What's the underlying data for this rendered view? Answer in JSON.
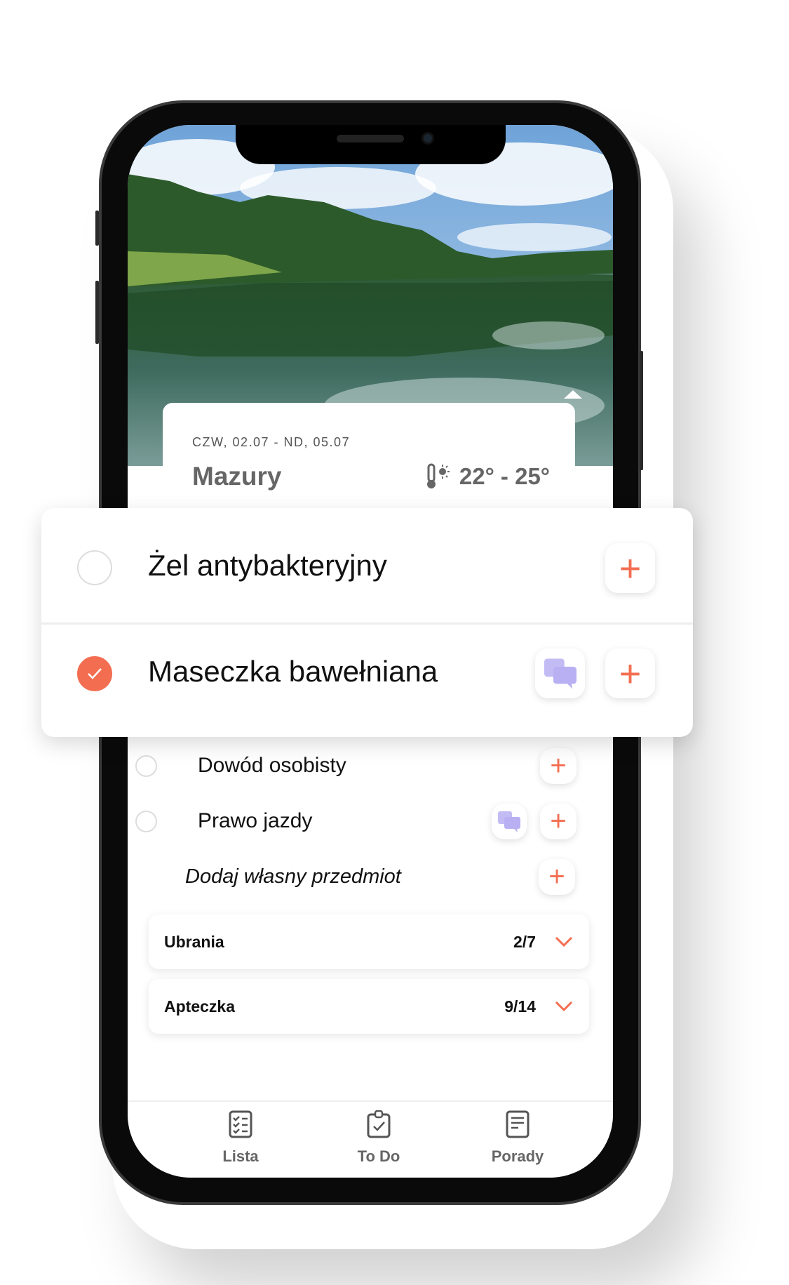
{
  "trip": {
    "dates": "CZW, 02.07 - ND, 05.07",
    "place": "Mazury",
    "temperature": "22° - 25°",
    "temp_icon": "thermometer-sun-icon"
  },
  "featured_items": [
    {
      "label": "Żel antybakteryjny",
      "checked": false,
      "has_comment": false
    },
    {
      "label": "Maseczka bawełniana",
      "checked": true,
      "has_comment": true
    }
  ],
  "items": [
    {
      "label": "Dowód osobisty",
      "checked": false,
      "has_comment": false
    },
    {
      "label": "Prawo jazdy",
      "checked": false,
      "has_comment": true
    }
  ],
  "add_custom": {
    "placeholder": "Dodaj własny przedmiot"
  },
  "categories": [
    {
      "name": "Ubrania",
      "count": "2/7"
    },
    {
      "name": "Apteczka",
      "count": "9/14"
    }
  ],
  "tabs": [
    {
      "label": "Lista",
      "icon": "checklist-icon"
    },
    {
      "label": "To Do",
      "icon": "clipboard-check-icon"
    },
    {
      "label": "Porady",
      "icon": "document-icon"
    }
  ],
  "colors": {
    "accent": "#f36e51",
    "comment": "#b8b0f2"
  }
}
